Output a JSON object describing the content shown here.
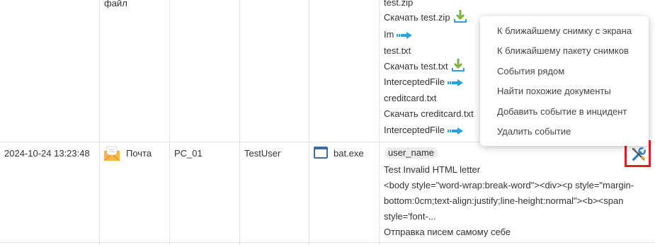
{
  "row1": {
    "type_text": "файл",
    "details": [
      "test.zip",
      "Скачать test.zip",
      "Im",
      "test.txt",
      "Скачать test.txt",
      "InterceptedFile",
      "creditcard.txt",
      "Скачать creditcard.txt",
      "InterceptedFile"
    ],
    "icons": {
      "download": "download-icon",
      "forward": "arrow-right-icon"
    }
  },
  "row2": {
    "datetime": "2024-10-24 13:23:48",
    "channel": "Почта",
    "computer": "PC_01",
    "user": "TestUser",
    "process": "bat.exe",
    "tag": "user_name",
    "subject": "Test Invalid HTML letter",
    "body_lines": [
      "<body style=\"word-wrap:break-word\"><div><p style=\"margin-",
      "bottom:0cm;text-align:justify;line-height:normal\"><b><span",
      "style='font-..."
    ],
    "rule": "Отправка писем самому себе",
    "icons": {
      "channel": "mail-icon",
      "process": "window-icon",
      "tools": "tools-icon"
    }
  },
  "context_menu": {
    "items": [
      "К ближайшему снимку с экрана",
      "К ближайшему пакету снимков",
      "События рядом",
      "Найти похожие документы",
      "Добавить событие в инцидент",
      "Удалить событие"
    ]
  },
  "colors": {
    "download_green": "#7cb342",
    "arrow_blue": "#29a3e0",
    "highlight_red": "#e01e1e",
    "mail_orange": "#f5a623"
  }
}
